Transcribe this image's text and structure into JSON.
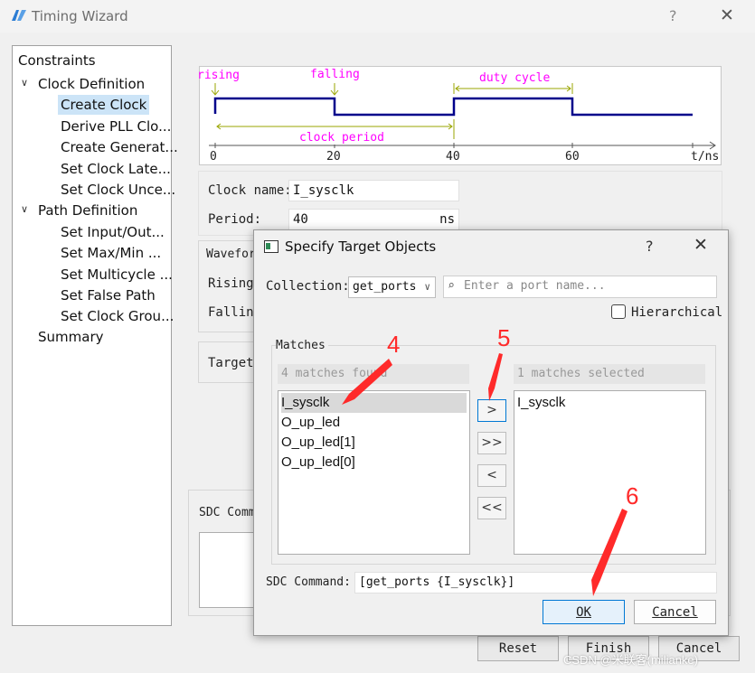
{
  "window": {
    "title": "Timing Wizard",
    "help": "?",
    "close": "✕"
  },
  "tree": {
    "root": "Constraints",
    "clock_def": "Clock Definition",
    "clock_items": [
      "Create Clock",
      "Derive PLL Clo...",
      "Create Generat...",
      "Set Clock Late...",
      "Set Clock Unce..."
    ],
    "path_def": "Path Definition",
    "path_items": [
      "Set Input/Out...",
      "Set Max/Min ...",
      "Set Multicycle ...",
      "Set False Path",
      "Set Clock Grou..."
    ],
    "summary": "Summary"
  },
  "waveform": {
    "rising": "rising",
    "falling": "falling",
    "duty_cycle": "duty cycle",
    "clock_period": "clock period",
    "ticks": [
      "0",
      "20",
      "40",
      "60"
    ],
    "unit": "t/ns"
  },
  "form": {
    "clock_name_label": "Clock name:",
    "clock_name_value": "I_sysclk",
    "period_label": "Period:",
    "period_value": "40",
    "period_unit": "ns",
    "waveform_label": "Wavefor",
    "rising_label": "Rising:",
    "falling_label": "Falling",
    "targets_label": "Targets",
    "sdc_label": "SDC Comm"
  },
  "buttons": {
    "reset": "Reset",
    "finish": "Finish",
    "cancel": "Cancel"
  },
  "dialog": {
    "title": "Specify Target Objects",
    "help": "?",
    "close": "✕",
    "collection_label": "Collection:",
    "collection_value": "get_ports",
    "search_placeholder": "Enter a port name...",
    "hierarchical_label": "Hierarchical",
    "matches_label": "Matches",
    "found_text": "4 matches found",
    "selected_text": "1 matches selected",
    "matches": [
      "I_sysclk",
      "O_up_led",
      "O_up_led[1]",
      "O_up_led[0]"
    ],
    "selected": [
      "I_sysclk"
    ],
    "arrow_buttons": [
      ">",
      ">>",
      "<",
      "<<"
    ],
    "sdc_command_label": "SDC Command:",
    "sdc_command_value": "[get_ports {I_sysclk}]",
    "ok": "OK",
    "cancel": "Cancel"
  },
  "annotations": [
    "4",
    "5",
    "6"
  ],
  "watermark": "CSDN @米联客(milianke)",
  "colors": {
    "accent": "#0078d4",
    "signal": "#00008b",
    "wave_label": "#ff00ff",
    "measure": "#9aa500",
    "annotation": "#ff2a2a"
  }
}
